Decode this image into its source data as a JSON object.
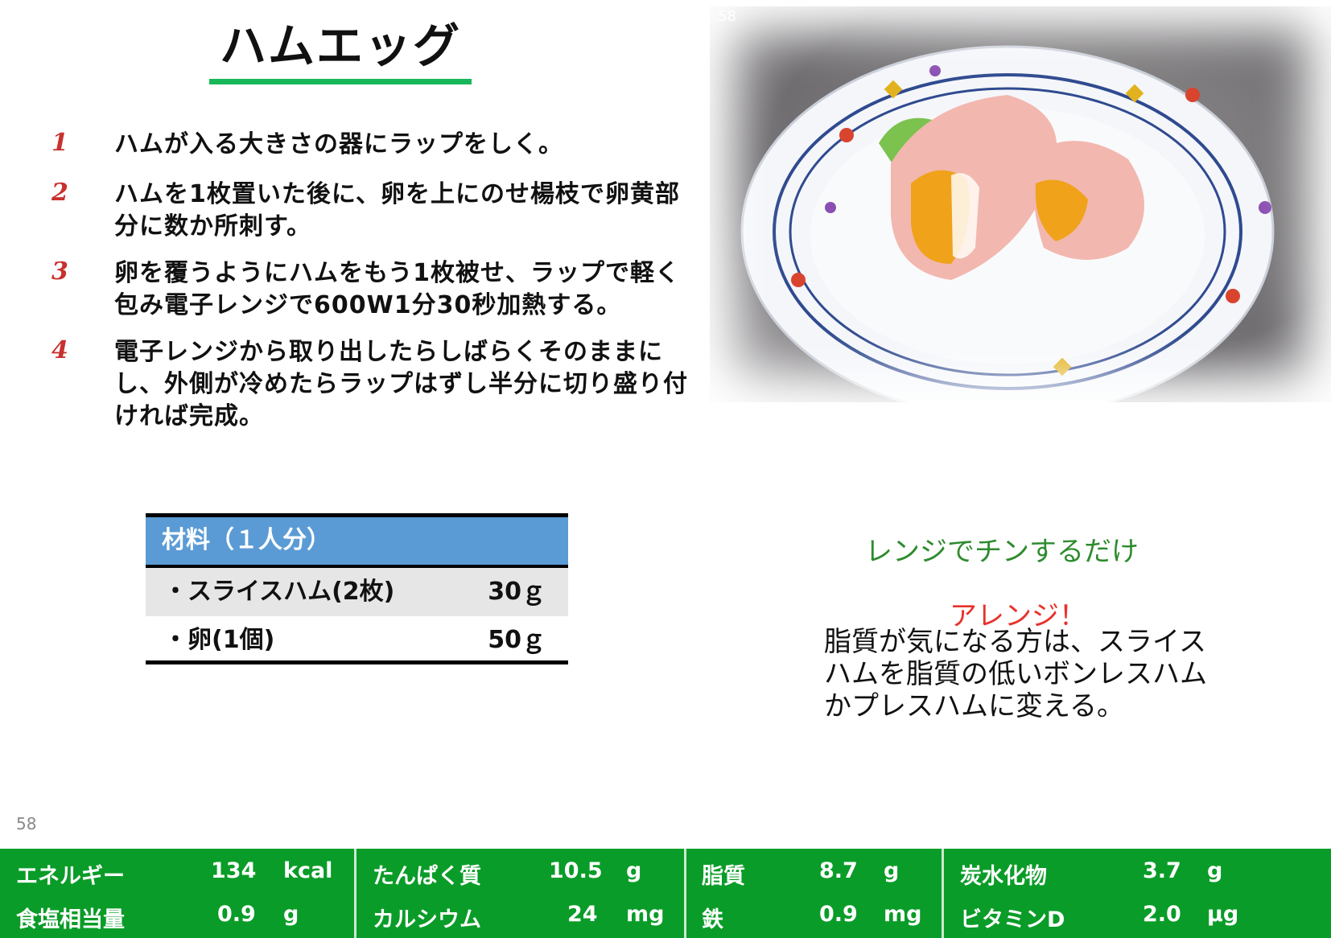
{
  "title": "ハムエッグ",
  "steps": [
    {
      "num": "1",
      "text": "ハムが入る大きさの器にラップをしく。"
    },
    {
      "num": "2",
      "text": "ハムを1枚置いた後に、卵を上にのせ楊枝で卵黄部分に数か所刺す。"
    },
    {
      "num": "3",
      "text": "卵を覆うようにハムをもう1枚被せ、ラップで軽く包み電子レンジで600W1分30秒加熱する。"
    },
    {
      "num": "4",
      "text": "電子レンジから取り出したらしばらくそのままにし、外側が冷めたらラップはずし半分に切り盛り付ければ完成。"
    }
  ],
  "photo": {
    "page_label": "58"
  },
  "ingredients": {
    "header": "材料（１人分）",
    "rows": [
      {
        "name": "・スライスハム(2枚)",
        "amount": "30ｇ"
      },
      {
        "name": "・卵(1個)",
        "amount": "50ｇ"
      }
    ]
  },
  "tip": {
    "main": "レンジでチンするだけ",
    "arrange_title": "アレンジ！",
    "arrange_body": "脂質が気になる方は、スライスハムを脂質の低いボンレスハムかプレスハムに変える。"
  },
  "page_number": "58",
  "nutrition": [
    {
      "label": "エネルギー",
      "value": "134",
      "unit": "kcal"
    },
    {
      "label": "たんぱく質",
      "value": "10.5",
      "unit": "g"
    },
    {
      "label": "脂質",
      "value": "8.7",
      "unit": "g"
    },
    {
      "label": "炭水化物",
      "value": "3.7",
      "unit": "g"
    },
    {
      "label": "食塩相当量",
      "value": "0.9",
      "unit": "g"
    },
    {
      "label": "カルシウム",
      "value": "24",
      "unit": "mg"
    },
    {
      "label": "鉄",
      "value": "0.9",
      "unit": "mg"
    },
    {
      "label": "ビタミンD",
      "value": "2.0",
      "unit": "μg"
    }
  ],
  "colors": {
    "accent_green": "#0a9c28",
    "step_red": "#c8312f",
    "table_blue": "#5b9bd5"
  }
}
